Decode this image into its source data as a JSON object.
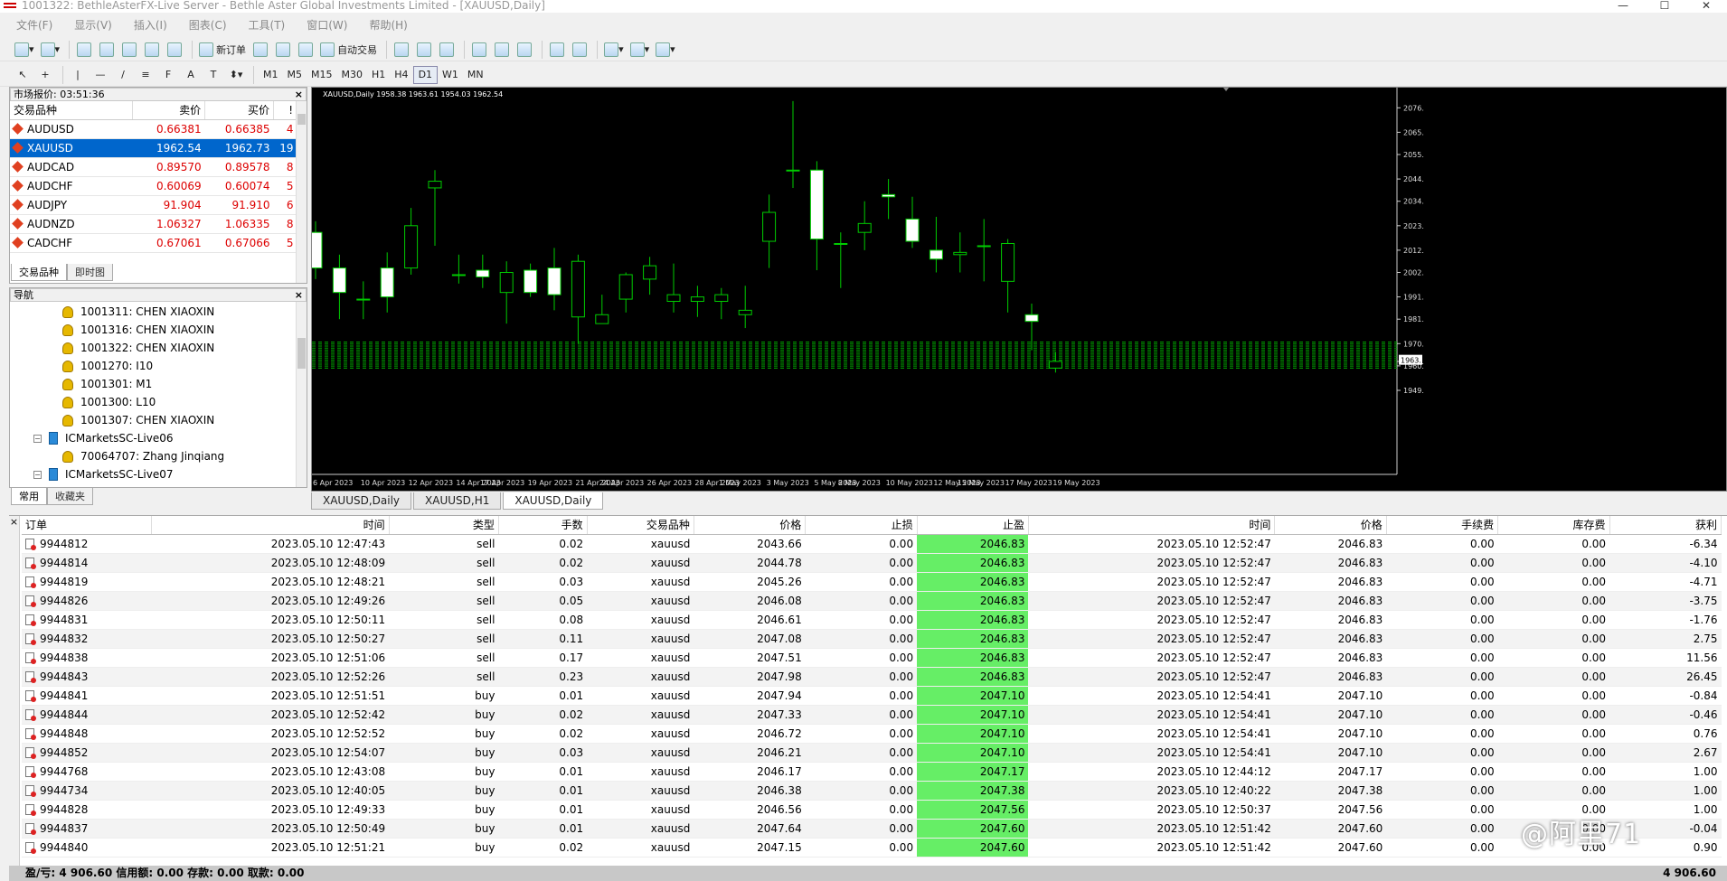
{
  "window": {
    "title": "1001322: BethleAsterFX-Live Server - Bethle Aster Global Investments Limited - [XAUUSD,Daily]",
    "min": "—",
    "max": "☐",
    "close": "✕"
  },
  "menu": [
    "文件(F)",
    "显示(V)",
    "插入(I)",
    "图表(C)",
    "工具(T)",
    "窗口(W)",
    "帮助(H)"
  ],
  "toolbar": {
    "new_order": "新订单",
    "auto_trade": "自动交易",
    "timeframes": [
      "M1",
      "M5",
      "M15",
      "M30",
      "H1",
      "H4",
      "D1",
      "W1",
      "MN"
    ],
    "active_timeframe": "D1"
  },
  "market_watch": {
    "title": "市场报价: 03:51:36",
    "headers": {
      "symbol": "交易品种",
      "bid": "卖价",
      "ask": "买价",
      "extra": "!"
    },
    "rows": [
      {
        "symbol": "AUDUSD",
        "bid": "0.66381",
        "ask": "0.66385",
        "spread": "4"
      },
      {
        "symbol": "XAUUSD",
        "bid": "1962.54",
        "ask": "1962.73",
        "spread": "19"
      },
      {
        "symbol": "AUDCAD",
        "bid": "0.89570",
        "ask": "0.89578",
        "spread": "8"
      },
      {
        "symbol": "AUDCHF",
        "bid": "0.60069",
        "ask": "0.60074",
        "spread": "5"
      },
      {
        "symbol": "AUDJPY",
        "bid": "91.904",
        "ask": "91.910",
        "spread": "6"
      },
      {
        "symbol": "AUDNZD",
        "bid": "1.06327",
        "ask": "1.06335",
        "spread": "8"
      },
      {
        "symbol": "CADCHF",
        "bid": "0.67061",
        "ask": "0.67066",
        "spread": "5"
      }
    ],
    "selected_symbol": "XAUUSD",
    "tabs": [
      "交易品种",
      "即时图"
    ]
  },
  "navigator": {
    "title": "导航",
    "items": [
      {
        "label": "1001311: CHEN XIAOXIN",
        "kind": "account",
        "indent": 3
      },
      {
        "label": "1001316: CHEN XIAOXIN",
        "kind": "account",
        "indent": 3
      },
      {
        "label": "1001322: CHEN XIAOXIN",
        "kind": "account",
        "indent": 3
      },
      {
        "label": "1001270: I10",
        "kind": "account",
        "indent": 3
      },
      {
        "label": "1001301: M1",
        "kind": "account",
        "indent": 3
      },
      {
        "label": "1001300: L10",
        "kind": "account",
        "indent": 3
      },
      {
        "label": "1001307: CHEN XIAOXIN",
        "kind": "account",
        "indent": 3
      },
      {
        "label": "ICMarketsSC-Live06",
        "kind": "server",
        "indent": 1
      },
      {
        "label": "70064707: Zhang Jinqiang",
        "kind": "account",
        "indent": 3
      },
      {
        "label": "ICMarketsSC-Live07",
        "kind": "server",
        "indent": 1
      }
    ],
    "tabs": [
      "常用",
      "收藏夹"
    ]
  },
  "chart_tabs": [
    "XAUUSD,Daily",
    "XAUUSD,H1",
    "XAUUSD,Daily"
  ],
  "chart_data": {
    "type": "candlestick",
    "title": "XAUUSD,Daily  1958.38 1963.61 1954.03 1962.54",
    "x": [
      "6 Apr 2023",
      "7 Apr 2023",
      "10 Apr 2023",
      "11 Apr 2023",
      "12 Apr 2023",
      "13 Apr 2023",
      "14 Apr 2023",
      "17 Apr 2023",
      "18 Apr 2023",
      "19 Apr 2023",
      "20 Apr 2023",
      "21 Apr 2023",
      "24 Apr 2023",
      "25 Apr 2023",
      "26 Apr 2023",
      "27 Apr 2023",
      "28 Apr 2023",
      "1 May 2023",
      "2 May 2023",
      "3 May 2023",
      "4 May 2023",
      "5 May 2023",
      "8 May 2023",
      "9 May 2023",
      "10 May 2023",
      "11 May 2023",
      "12 May 2023",
      "15 May 2023",
      "16 May 2023",
      "17 May 2023",
      "18 May 2023",
      "19 May 2023"
    ],
    "open": [
      2020,
      2004,
      1990,
      2004,
      2004,
      2040,
      2001,
      2003,
      1993,
      2003,
      2004,
      1982,
      1979,
      1990,
      1999,
      1989,
      1989,
      1989,
      1983,
      2016,
      2048,
      2048,
      2015,
      2020,
      2037,
      2026,
      2012,
      2010,
      2014,
      1998,
      1983,
      1959
    ],
    "close": [
      2004,
      1993,
      1990,
      1991,
      2023,
      2043,
      2001,
      2000,
      2002,
      1993,
      1992,
      2007,
      1983,
      2001,
      2005,
      1992,
      1991,
      1992,
      1985,
      2029,
      2048,
      2017,
      2015,
      2024,
      2036,
      2016,
      2008,
      2011,
      2014,
      2015,
      1980,
      1962
    ],
    "high": [
      2025,
      2010,
      1998,
      2011,
      2031,
      2048,
      2010,
      2010,
      2007,
      2006,
      2013,
      2010,
      1992,
      2002,
      2009,
      2006,
      1996,
      1995,
      1996,
      2037,
      2079,
      2052,
      2020,
      2034,
      2044,
      2036,
      2027,
      2020,
      2026,
      2017,
      1988,
      1966
    ],
    "low": [
      1999,
      1981,
      1981,
      1984,
      2001,
      2014,
      1997,
      1995,
      1979,
      1991,
      1985,
      1970,
      1979,
      1984,
      1992,
      1984,
      1982,
      1981,
      1977,
      2004,
      2040,
      2003,
      1995,
      2012,
      2026,
      2013,
      2002,
      2002,
      1998,
      1984,
      1967,
      1957
    ],
    "ylim": [
      1949,
      2081
    ],
    "yticks": [
      "2076.",
      "2065.",
      "2055.",
      "2044.",
      "2034.",
      "2023.",
      "2012.",
      "2002.",
      "1991.",
      "1981.",
      "1970.",
      "1962.",
      "1960.",
      "1949."
    ],
    "ytick_values": [
      2076,
      2065,
      2055,
      2044,
      2034,
      2023,
      2012,
      2002,
      1991,
      1981,
      1970,
      1962,
      1960,
      1949
    ],
    "xtick_labels": [
      "6 Apr 2023",
      "10 Apr 2023",
      "12 Apr 2023",
      "14 Apr 2023",
      "17 Apr 2023",
      "19 Apr 2023",
      "21 Apr 2023",
      "24 Apr 2023",
      "26 Apr 2023",
      "28 Apr 2023",
      "1 May 2023",
      "3 May 2023",
      "5 May 2023",
      "8 May 2023",
      "10 May 2023",
      "12 May 2023",
      "15 May 2023",
      "17 May 2023",
      "19 May 2023"
    ],
    "xtick_indices": [
      0,
      2,
      4,
      6,
      7,
      9,
      11,
      12,
      14,
      16,
      17,
      19,
      21,
      22,
      24,
      26,
      27,
      29,
      31
    ],
    "current_price": 1962.54,
    "colors": {
      "background": "#000000",
      "bull": "#000000",
      "bear": "#ffffff",
      "wick": "#00cc00",
      "grid": "#1e5a1e",
      "order_lines": "#00aa00"
    }
  },
  "terminal": {
    "headers": [
      "订单",
      "时间",
      "类型",
      "手数",
      "交易品种",
      "价格",
      "止损",
      "止盈",
      "时间",
      "价格",
      "手续费",
      "库存费",
      "获利"
    ],
    "rows": [
      [
        "9944812",
        "2023.05.10 12:47:43",
        "sell",
        "0.02",
        "xauusd",
        "2043.66",
        "0.00",
        "2046.83",
        "2023.05.10 12:52:47",
        "2046.83",
        "0.00",
        "0.00",
        "-6.34"
      ],
      [
        "9944814",
        "2023.05.10 12:48:09",
        "sell",
        "0.02",
        "xauusd",
        "2044.78",
        "0.00",
        "2046.83",
        "2023.05.10 12:52:47",
        "2046.83",
        "0.00",
        "0.00",
        "-4.10"
      ],
      [
        "9944819",
        "2023.05.10 12:48:21",
        "sell",
        "0.03",
        "xauusd",
        "2045.26",
        "0.00",
        "2046.83",
        "2023.05.10 12:52:47",
        "2046.83",
        "0.00",
        "0.00",
        "-4.71"
      ],
      [
        "9944826",
        "2023.05.10 12:49:26",
        "sell",
        "0.05",
        "xauusd",
        "2046.08",
        "0.00",
        "2046.83",
        "2023.05.10 12:52:47",
        "2046.83",
        "0.00",
        "0.00",
        "-3.75"
      ],
      [
        "9944831",
        "2023.05.10 12:50:11",
        "sell",
        "0.08",
        "xauusd",
        "2046.61",
        "0.00",
        "2046.83",
        "2023.05.10 12:52:47",
        "2046.83",
        "0.00",
        "0.00",
        "-1.76"
      ],
      [
        "9944832",
        "2023.05.10 12:50:27",
        "sell",
        "0.11",
        "xauusd",
        "2047.08",
        "0.00",
        "2046.83",
        "2023.05.10 12:52:47",
        "2046.83",
        "0.00",
        "0.00",
        "2.75"
      ],
      [
        "9944838",
        "2023.05.10 12:51:06",
        "sell",
        "0.17",
        "xauusd",
        "2047.51",
        "0.00",
        "2046.83",
        "2023.05.10 12:52:47",
        "2046.83",
        "0.00",
        "0.00",
        "11.56"
      ],
      [
        "9944843",
        "2023.05.10 12:52:26",
        "sell",
        "0.23",
        "xauusd",
        "2047.98",
        "0.00",
        "2046.83",
        "2023.05.10 12:52:47",
        "2046.83",
        "0.00",
        "0.00",
        "26.45"
      ],
      [
        "9944841",
        "2023.05.10 12:51:51",
        "buy",
        "0.01",
        "xauusd",
        "2047.94",
        "0.00",
        "2047.10",
        "2023.05.10 12:54:41",
        "2047.10",
        "0.00",
        "0.00",
        "-0.84"
      ],
      [
        "9944844",
        "2023.05.10 12:52:42",
        "buy",
        "0.02",
        "xauusd",
        "2047.33",
        "0.00",
        "2047.10",
        "2023.05.10 12:54:41",
        "2047.10",
        "0.00",
        "0.00",
        "-0.46"
      ],
      [
        "9944848",
        "2023.05.10 12:52:52",
        "buy",
        "0.02",
        "xauusd",
        "2046.72",
        "0.00",
        "2047.10",
        "2023.05.10 12:54:41",
        "2047.10",
        "0.00",
        "0.00",
        "0.76"
      ],
      [
        "9944852",
        "2023.05.10 12:54:07",
        "buy",
        "0.03",
        "xauusd",
        "2046.21",
        "0.00",
        "2047.10",
        "2023.05.10 12:54:41",
        "2047.10",
        "0.00",
        "0.00",
        "2.67"
      ],
      [
        "9944768",
        "2023.05.10 12:43:08",
        "buy",
        "0.01",
        "xauusd",
        "2046.17",
        "0.00",
        "2047.17",
        "2023.05.10 12:44:12",
        "2047.17",
        "0.00",
        "0.00",
        "1.00"
      ],
      [
        "9944734",
        "2023.05.10 12:40:05",
        "buy",
        "0.01",
        "xauusd",
        "2046.38",
        "0.00",
        "2047.38",
        "2023.05.10 12:40:22",
        "2047.38",
        "0.00",
        "0.00",
        "1.00"
      ],
      [
        "9944828",
        "2023.05.10 12:49:33",
        "buy",
        "0.01",
        "xauusd",
        "2046.56",
        "0.00",
        "2047.56",
        "2023.05.10 12:50:37",
        "2047.56",
        "0.00",
        "0.00",
        "1.00"
      ],
      [
        "9944837",
        "2023.05.10 12:50:49",
        "buy",
        "0.01",
        "xauusd",
        "2047.64",
        "0.00",
        "2047.60",
        "2023.05.10 12:51:42",
        "2047.60",
        "0.00",
        "0.00",
        "-0.04"
      ],
      [
        "9944840",
        "2023.05.10 12:51:21",
        "buy",
        "0.02",
        "xauusd",
        "2047.15",
        "0.00",
        "2047.60",
        "2023.05.10 12:51:42",
        "2047.60",
        "0.00",
        "0.00",
        "0.90"
      ]
    ],
    "status": "盈/亏: 4 906.60  信用额: 0.00  存款: 0.00  取款: 0.00",
    "total": "4 906.60"
  },
  "watermark": "@阿里71"
}
